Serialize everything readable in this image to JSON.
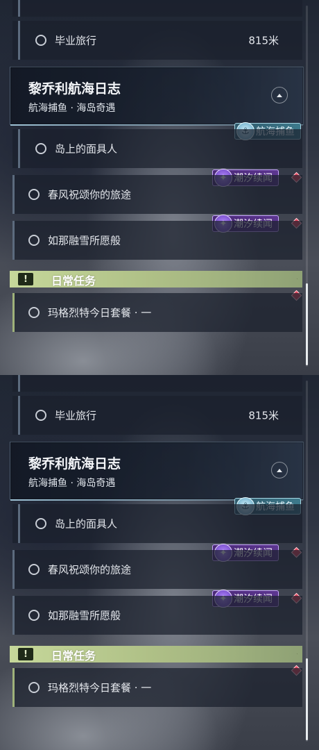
{
  "quests": {
    "graduation_trip": {
      "label": "毕业旅行",
      "distance": "815米"
    },
    "chain_title": "黎乔利航海日志",
    "chain_subtitle": "航海捕鱼 · 海岛奇遇",
    "island_mask": "岛上的面具人",
    "spring_breeze": "春风祝颂你的旅途",
    "melting_snow": "如那融雪所愿般",
    "daily_header": "日常任务",
    "daily_tiny": "·",
    "daily_quest": "玛格烈特今日套餐 · 一"
  },
  "badges": {
    "fishing": "航海捕鱼",
    "tide": "潮汐续闻"
  },
  "icons": {
    "collapse": "chevron-up-icon",
    "fishing_badge": "fish-icon",
    "tide_badge": "star-icon",
    "track_marker": "diamond-icon",
    "daily": "exclamation-icon"
  },
  "colors": {
    "tide_badge": "#5c3690",
    "fishing_badge": "#3d7a8c",
    "daily_header": "#c6d89a",
    "track_marker": "#e2445c"
  }
}
